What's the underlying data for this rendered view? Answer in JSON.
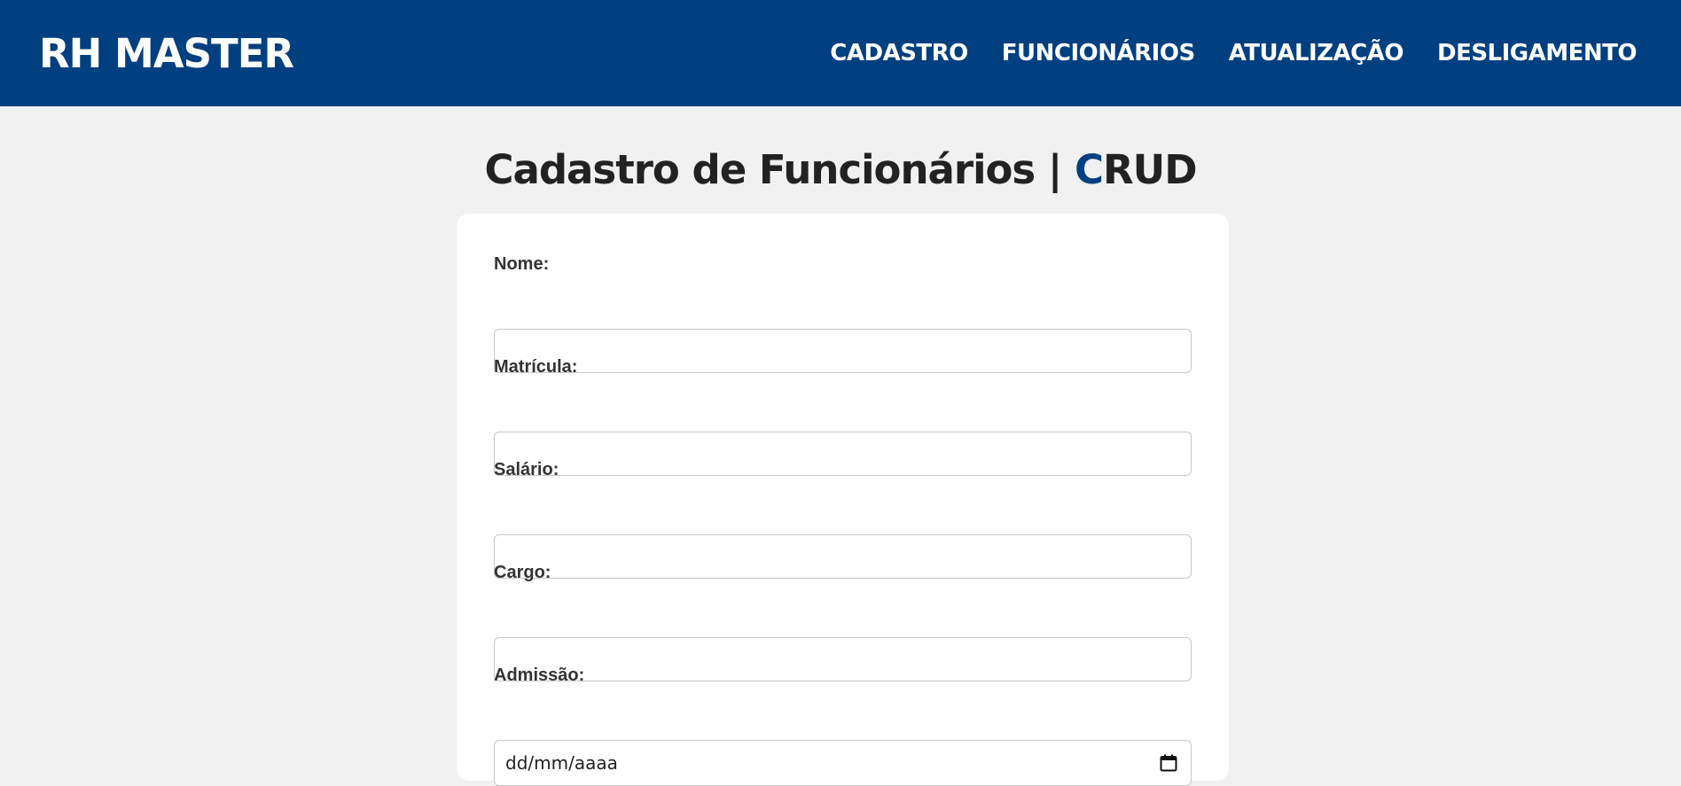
{
  "header": {
    "brand": "RH MASTER",
    "nav": [
      "CADASTRO",
      "FUNCIONÁRIOS",
      "ATUALIZAÇÃO",
      "DESLIGAMENTO"
    ]
  },
  "page": {
    "title_main": "Cadastro de Funcionários | ",
    "title_accent": "C",
    "title_rest": "RUD"
  },
  "form": {
    "fields": [
      {
        "label": "Nome:",
        "value": ""
      },
      {
        "label": "Matrícula:",
        "value": ""
      },
      {
        "label": "Salário:",
        "value": ""
      },
      {
        "label": "Cargo:",
        "value": ""
      }
    ],
    "admissao": {
      "label": "Admissão:",
      "placeholder": "dd/mm/aaaa"
    }
  },
  "colors": {
    "header_bg": "#003f80",
    "page_bg": "#f1f1f1",
    "accent": "#003f80"
  },
  "icons": {
    "date_picker": "calendar-icon"
  }
}
